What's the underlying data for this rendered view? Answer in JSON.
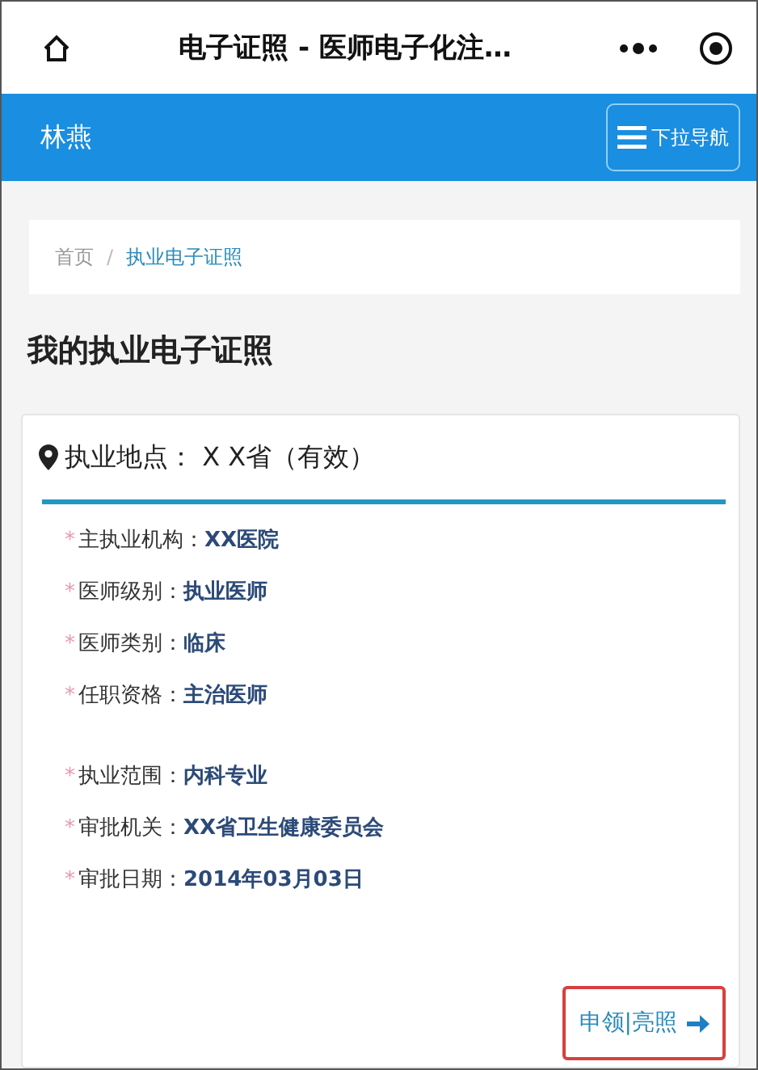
{
  "window": {
    "title": "电子证照 - 医师电子化注…"
  },
  "navbar": {
    "user": "林燕",
    "menu_button": "下拉导航"
  },
  "breadcrumb": [
    {
      "label": "首页",
      "current": false
    },
    {
      "separator": "/"
    },
    {
      "label": "执业电子证照",
      "current": true
    }
  ],
  "page_title": "我的执业电子证照",
  "card": {
    "location": "执业地点： X X省（有效）",
    "groups": [
      [
        {
          "marker": "*",
          "label": "主执业机构：",
          "value": "XX医院"
        },
        {
          "marker": "*",
          "label": "医师级别：",
          "value": "执业医师"
        },
        {
          "marker": "*",
          "label": "医师类别：",
          "value": "临床"
        },
        {
          "marker": "*",
          "label": "任职资格：",
          "value": "主治医师"
        }
      ],
      [
        {
          "marker": "*",
          "label": "执业范围：",
          "value": "内科专业"
        },
        {
          "marker": "*",
          "label": "审批机关：",
          "value": "XX省卫生健康委员会"
        },
        {
          "marker": "*",
          "label": "审批日期：",
          "value": "2014年03月03日"
        }
      ]
    ],
    "action": "申领|亮照"
  }
}
